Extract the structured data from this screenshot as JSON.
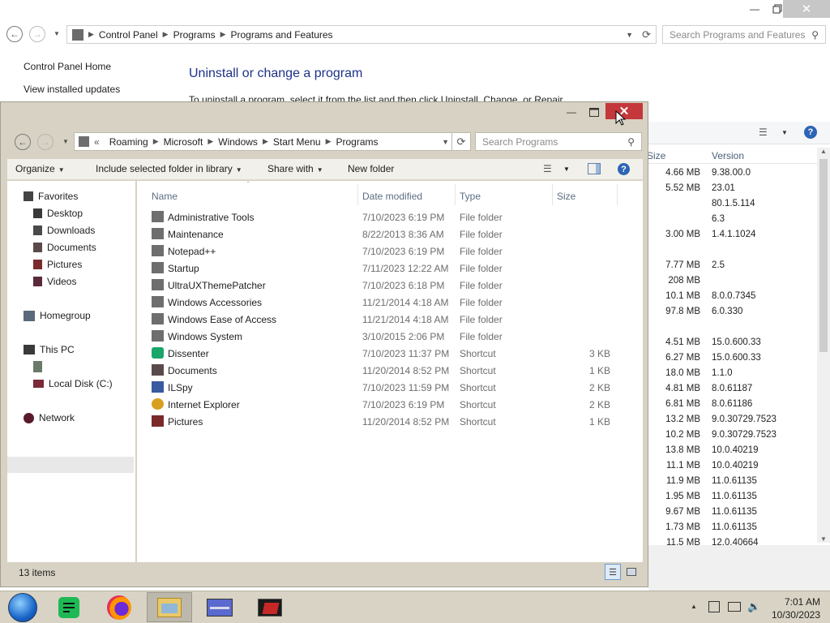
{
  "bg_window": {
    "address": [
      "Control Panel",
      "Programs",
      "Programs and Features"
    ],
    "search_placeholder": "Search Programs and Features",
    "left_links": [
      "Control Panel Home",
      "View installed updates"
    ],
    "heading": "Uninstall or change a program",
    "description": "To uninstall a program, select it from the list and then click Uninstall, Change, or Repair.",
    "columns": {
      "size": "Size",
      "version": "Version"
    },
    "rows": [
      {
        "size": "4.66 MB",
        "version": "9.38.00.0"
      },
      {
        "size": "5.52 MB",
        "version": "23.01"
      },
      {
        "size": "",
        "version": "80.1.5.114"
      },
      {
        "size": "",
        "version": "6.3"
      },
      {
        "size": "3.00 MB",
        "version": "1.4.1.1024"
      },
      {
        "size": "",
        "version": ""
      },
      {
        "size": "7.77 MB",
        "version": "2.5"
      },
      {
        "size": "208 MB",
        "version": ""
      },
      {
        "size": "10.1 MB",
        "version": "8.0.0.7345"
      },
      {
        "size": "97.8 MB",
        "version": "6.0.330"
      },
      {
        "size": "",
        "version": ""
      },
      {
        "size": "4.51 MB",
        "version": "15.0.600.33"
      },
      {
        "size": "6.27 MB",
        "version": "15.0.600.33"
      },
      {
        "size": "18.0 MB",
        "version": "1.1.0"
      },
      {
        "size": "4.81 MB",
        "version": "8.0.61187"
      },
      {
        "size": "6.81 MB",
        "version": "8.0.61186"
      },
      {
        "size": "13.2 MB",
        "version": "9.0.30729.7523"
      },
      {
        "size": "10.2 MB",
        "version": "9.0.30729.7523"
      },
      {
        "size": "13.8 MB",
        "version": "10.0.40219"
      },
      {
        "size": "11.1 MB",
        "version": "10.0.40219"
      },
      {
        "size": "11.9 MB",
        "version": "11.0.61135"
      },
      {
        "size": "1.95 MB",
        "version": "11.0.61135"
      },
      {
        "size": "9.67 MB",
        "version": "11.0.61135"
      },
      {
        "size": "1.73 MB",
        "version": "11.0.61135"
      },
      {
        "size": "11.5 MB",
        "version": "12.0.40664"
      }
    ]
  },
  "explorer": {
    "address": [
      "Roaming",
      "Microsoft",
      "Windows",
      "Start Menu",
      "Programs"
    ],
    "address_prefix": "«",
    "search_placeholder": "Search Programs",
    "commands": {
      "organize": "Organize",
      "include": "Include selected folder in library",
      "share": "Share with",
      "new_folder": "New folder"
    },
    "nav": {
      "favorites": "Favorites",
      "desktop": "Desktop",
      "downloads": "Downloads",
      "documents": "Documents",
      "pictures": "Pictures",
      "videos": "Videos",
      "homegroup": "Homegroup",
      "this_pc": "This PC",
      "local_disk": "Local Disk (C:)",
      "network": "Network"
    },
    "columns": {
      "name": "Name",
      "date": "Date modified",
      "type": "Type",
      "size": "Size"
    },
    "files": [
      {
        "name": "Administrative Tools",
        "date": "7/10/2023 6:19 PM",
        "type": "File folder",
        "size": "",
        "icon": "folder-icon"
      },
      {
        "name": "Maintenance",
        "date": "8/22/2013 8:36 AM",
        "type": "File folder",
        "size": "",
        "icon": "folder-icon"
      },
      {
        "name": "Notepad++",
        "date": "7/10/2023 6:19 PM",
        "type": "File folder",
        "size": "",
        "icon": "folder-icon"
      },
      {
        "name": "Startup",
        "date": "7/11/2023 12:22 AM",
        "type": "File folder",
        "size": "",
        "icon": "folder-icon"
      },
      {
        "name": "UltraUXThemePatcher",
        "date": "7/10/2023 6:18 PM",
        "type": "File folder",
        "size": "",
        "icon": "folder-icon"
      },
      {
        "name": "Windows Accessories",
        "date": "11/21/2014 4:18 AM",
        "type": "File folder",
        "size": "",
        "icon": "folder-icon"
      },
      {
        "name": "Windows Ease of Access",
        "date": "11/21/2014 4:18 AM",
        "type": "File folder",
        "size": "",
        "icon": "folder-icon"
      },
      {
        "name": "Windows System",
        "date": "3/10/2015 2:06 PM",
        "type": "File folder",
        "size": "",
        "icon": "folder-icon"
      },
      {
        "name": "Dissenter",
        "date": "7/10/2023 11:37 PM",
        "type": "Shortcut",
        "size": "3 KB",
        "icon": "dissenter-icon"
      },
      {
        "name": "Documents",
        "date": "11/20/2014 8:52 PM",
        "type": "Shortcut",
        "size": "1 KB",
        "icon": "documents-icon"
      },
      {
        "name": "ILSpy",
        "date": "7/10/2023 11:59 PM",
        "type": "Shortcut",
        "size": "2 KB",
        "icon": "ilspy-icon"
      },
      {
        "name": "Internet Explorer",
        "date": "7/10/2023 6:19 PM",
        "type": "Shortcut",
        "size": "2 KB",
        "icon": "ie-icon"
      },
      {
        "name": "Pictures",
        "date": "11/20/2014 8:52 PM",
        "type": "Shortcut",
        "size": "1 KB",
        "icon": "pictures-icon"
      }
    ],
    "status": "13 items"
  },
  "taskbar": {
    "time": "7:01 AM",
    "date": "10/30/2023"
  },
  "colors": {
    "close_red": "#c4373a",
    "chrome": "#d7d2c3",
    "link_blue": "#1e4e8c",
    "heading_blue": "#1e3287"
  }
}
